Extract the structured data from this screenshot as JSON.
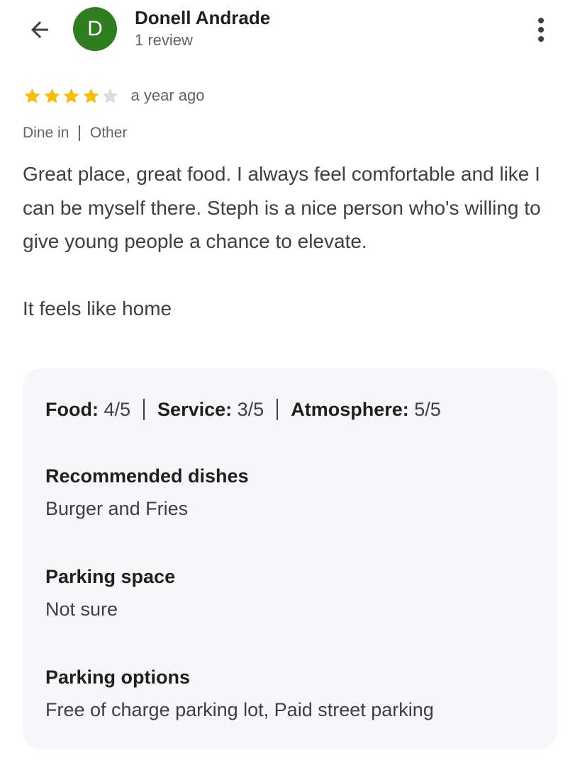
{
  "header": {
    "back_icon": "arrow-left-icon",
    "avatar_letter": "D",
    "avatar_color": "#2e7d1f",
    "reviewer_name": "Donell Andrade",
    "review_count": "1 review",
    "more_icon": "more-vertical-icon"
  },
  "rating": {
    "stars": 4,
    "max_stars": 5,
    "star_color": "#fbbc04",
    "empty_star_color": "#dadce0",
    "time_ago": "a year ago"
  },
  "tags": [
    "Dine in",
    "Other"
  ],
  "review": {
    "paragraphs": [
      "Great place, great food. I always feel comfortable and like I can be myself there. Steph is a nice person who's willing to give young people a chance to elevate.",
      "It feels like home"
    ]
  },
  "details": {
    "sub_ratings": [
      {
        "label": "Food",
        "value": "4/5"
      },
      {
        "label": "Service",
        "value": "3/5"
      },
      {
        "label": "Atmosphere",
        "value": "5/5"
      }
    ],
    "sections": [
      {
        "title": "Recommended dishes",
        "value": "Burger and Fries"
      },
      {
        "title": "Parking space",
        "value": "Not sure"
      },
      {
        "title": "Parking options",
        "value": "Free of charge parking lot, Paid street parking"
      }
    ]
  }
}
